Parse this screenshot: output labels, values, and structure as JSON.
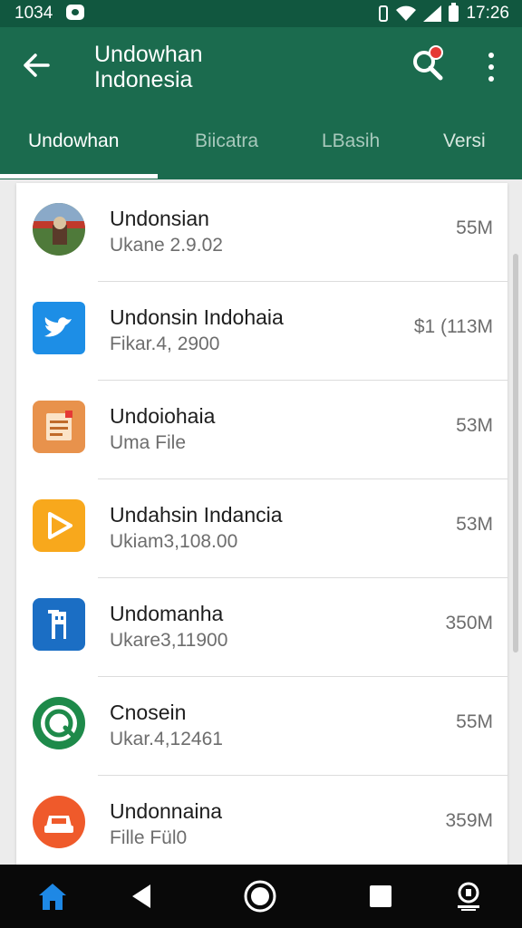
{
  "status_bar": {
    "time_left": "1034",
    "time_right": "17:26",
    "icons": [
      "notification-icon",
      "vibrate-icon",
      "wifi-icon",
      "signal-icon",
      "battery-icon"
    ]
  },
  "app_bar": {
    "title_line1": "Undowhan",
    "title_line2": "Indonesia",
    "icons": [
      "back-arrow-icon",
      "search-icon",
      "more-vert-icon"
    ],
    "color": "#1b6b4e"
  },
  "tabs": [
    {
      "label": "Undowhan",
      "active": true
    },
    {
      "label": "Biicatra",
      "active": false
    },
    {
      "label": "LBasih",
      "active": false
    },
    {
      "label": "Versi",
      "active": false
    }
  ],
  "list": [
    {
      "title": "Undonsian",
      "subtitle": "Ukane 2.9.02",
      "size": "55M",
      "icon": "photo-thumbnail-icon"
    },
    {
      "title": "Undonsin Indohaia",
      "subtitle": "Fikar.4, 2900",
      "size": "$1 (113M",
      "icon": "twitter-bird-icon"
    },
    {
      "title": "Undoiohaia",
      "subtitle": "Uma File",
      "size": "53M",
      "icon": "document-icon"
    },
    {
      "title": "Undahsin Indancia",
      "subtitle": "Ukiam3,108.00",
      "size": "53M",
      "icon": "play-icon"
    },
    {
      "title": "Undomanha",
      "subtitle": "Ukare3,11900",
      "size": "350M",
      "icon": "building-icon"
    },
    {
      "title": "Cnosein",
      "subtitle": "Ukar.4,12461",
      "size": "55M",
      "icon": "chat-circle-icon"
    },
    {
      "title": "Undonnaina",
      "subtitle": "Fille Fül0",
      "size": "359M",
      "icon": "car-icon"
    }
  ],
  "nav_bar": {
    "icons": [
      "home-icon",
      "back-triangle-icon",
      "home-circle-icon",
      "recents-square-icon",
      "assistant-icon"
    ]
  }
}
